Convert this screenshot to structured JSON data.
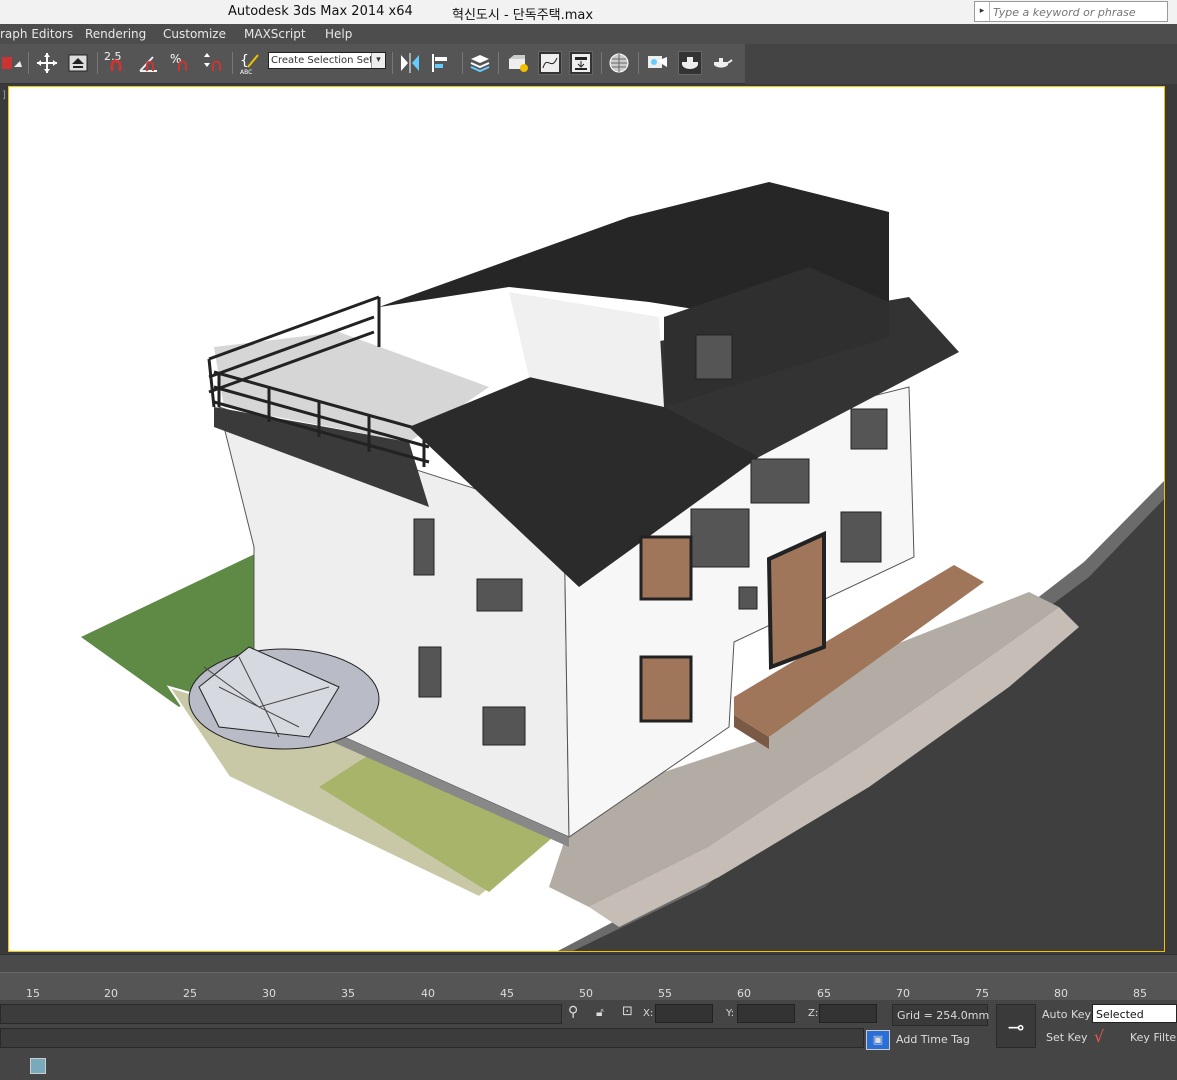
{
  "window": {
    "title": "Autodesk 3ds Max  2014 x64",
    "file": "혁신도시 - 단독주택.max"
  },
  "search": {
    "placeholder": "Type a keyword or phrase",
    "arrow": "▸"
  },
  "menu": {
    "items": [
      "raph Editors",
      "Rendering",
      "Customize",
      "MAXScript",
      "Help"
    ]
  },
  "toolbar": {
    "snap_label": "2.5",
    "selection_set_placeholder": "Create Selection Set",
    "icons": [
      "select-move-icon",
      "snap-toggle-icon",
      "angle-snap-icon",
      "percent-snap-icon",
      "spinner-snap-icon",
      "named-selection-icon",
      "mirror-icon",
      "align-icon",
      "layer-manager-icon",
      "scene-explorer-icon",
      "curve-editor-icon",
      "schematic-view-icon",
      "material-editor-icon",
      "render-setup-icon",
      "rendered-frame-icon",
      "render-icon"
    ]
  },
  "viewport": {
    "label": "]"
  },
  "timeline": {
    "ticks": [
      "15",
      "20",
      "25",
      "30",
      "35",
      "40",
      "45",
      "50",
      "55",
      "60",
      "65",
      "70",
      "75",
      "80",
      "85"
    ]
  },
  "status": {
    "x_label": "X:",
    "y_label": "Y:",
    "z_label": "Z:",
    "grid": "Grid = 254.0mm",
    "add_time_tag": "Add Time Tag",
    "auto_key": "Auto Key",
    "set_key": "Set Key",
    "selected": "Selected",
    "key_filters": "Key Filter",
    "key_icon": "⊸"
  },
  "colors": {
    "viewport_border": "#f2c200",
    "roof": "#2b2b2b",
    "wall": "#f4f4f4",
    "wood": "#a0765a",
    "road": "#3f3f3f",
    "grass": "#5e8a45"
  }
}
